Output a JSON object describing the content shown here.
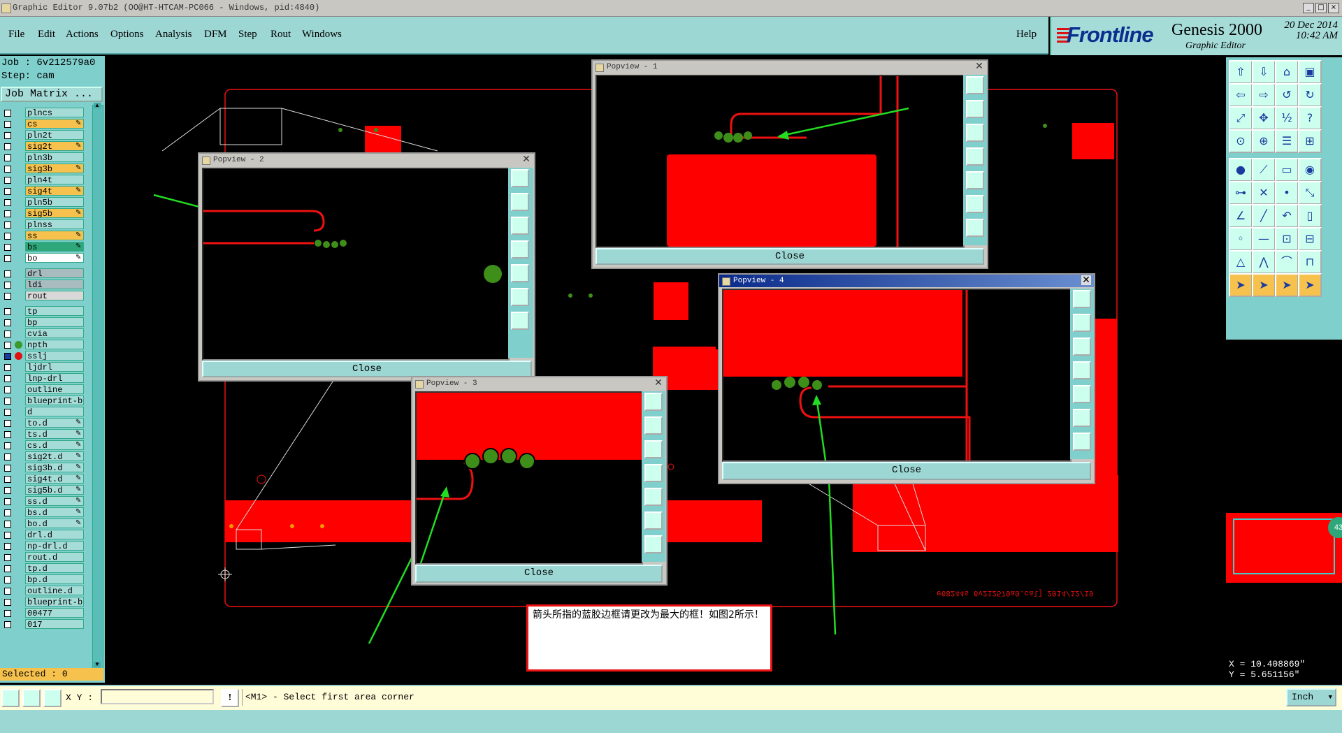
{
  "titlebar": {
    "title": "Graphic Editor 9.07b2 (OO@HT-HTCAM-PC066 - Windows, pid:4840)"
  },
  "menu": {
    "items": [
      "File",
      "Edit",
      "Actions",
      "Options",
      "Analysis",
      "DFM",
      "Step",
      "Rout",
      "Windows"
    ],
    "help": "Help"
  },
  "brand": {
    "logo": "Frontline",
    "product": "Genesis 2000",
    "subtitle": "Graphic Editor",
    "date": "20 Dec 2014",
    "time": "10:42 AM"
  },
  "left": {
    "job": "Job : 6v212579a0",
    "step": "Step: cam",
    "job_matrix": "Job Matrix ...",
    "layers": [
      {
        "name": "plncs",
        "color": "#a6dcd8"
      },
      {
        "name": "cs",
        "color": "#f6c24d",
        "editable": true
      },
      {
        "name": "pln2t",
        "color": "#a6dcd8"
      },
      {
        "name": "sig2t",
        "color": "#f6c24d",
        "editable": true
      },
      {
        "name": "pln3b",
        "color": "#a6dcd8"
      },
      {
        "name": "sig3b",
        "color": "#f6c24d",
        "editable": true
      },
      {
        "name": "pln4t",
        "color": "#a6dcd8"
      },
      {
        "name": "sig4t",
        "color": "#f6c24d",
        "editable": true
      },
      {
        "name": "pln5b",
        "color": "#a6dcd8"
      },
      {
        "name": "sig5b",
        "color": "#f6c24d",
        "editable": true
      },
      {
        "name": "plnss",
        "color": "#a6dcd8"
      },
      {
        "name": "ss",
        "color": "#f6c24d",
        "editable": true
      },
      {
        "name": "bs",
        "color": "#2ea87a",
        "editable": true
      },
      {
        "name": "bo",
        "color": "#ffffff",
        "editable": true
      },
      {
        "name": "drl",
        "color": "#a8bcc0"
      },
      {
        "name": "ldi",
        "color": "#a8bcc0"
      },
      {
        "name": "rout",
        "color": "#d8d8d8"
      },
      {
        "name": "tp",
        "color": "#a6dcd8"
      },
      {
        "name": "bp",
        "color": "#a6dcd8"
      },
      {
        "name": "cvia",
        "color": "#a6dcd8"
      },
      {
        "name": "npth",
        "color": "#a6dcd8",
        "marker": "#3a9a2a"
      },
      {
        "name": "sslj",
        "color": "#a6dcd8",
        "marker": "#e11111",
        "active": true
      },
      {
        "name": "ljdrl",
        "color": "#a6dcd8"
      },
      {
        "name": "lnp-drl",
        "color": "#a6dcd8"
      },
      {
        "name": "outline",
        "color": "#a6dcd8"
      },
      {
        "name": "blueprint-bo",
        "color": "#a6dcd8"
      },
      {
        "name": "d",
        "color": "#a6dcd8"
      },
      {
        "name": "to.d",
        "color": "#a6dcd8",
        "editable": true
      },
      {
        "name": "ts.d",
        "color": "#a6dcd8",
        "editable": true
      },
      {
        "name": "cs.d",
        "color": "#a6dcd8",
        "editable": true
      },
      {
        "name": "sig2t.d",
        "color": "#a6dcd8",
        "editable": true
      },
      {
        "name": "sig3b.d",
        "color": "#a6dcd8",
        "editable": true
      },
      {
        "name": "sig4t.d",
        "color": "#a6dcd8",
        "editable": true
      },
      {
        "name": "sig5b.d",
        "color": "#a6dcd8",
        "editable": true
      },
      {
        "name": "ss.d",
        "color": "#a6dcd8",
        "editable": true
      },
      {
        "name": "bs.d",
        "color": "#a6dcd8",
        "editable": true
      },
      {
        "name": "bo.d",
        "color": "#a6dcd8",
        "editable": true
      },
      {
        "name": "drl.d",
        "color": "#a6dcd8"
      },
      {
        "name": "np-drl.d",
        "color": "#a6dcd8"
      },
      {
        "name": "rout.d",
        "color": "#a6dcd8"
      },
      {
        "name": "tp.d",
        "color": "#a6dcd8"
      },
      {
        "name": "bp.d",
        "color": "#a6dcd8"
      },
      {
        "name": "outline.d",
        "color": "#a6dcd8"
      },
      {
        "name": "blueprint-bo",
        "color": "#a6dcd8"
      },
      {
        "name": "00477",
        "color": "#a6dcd8"
      },
      {
        "name": "017",
        "color": "#a6dcd8"
      }
    ],
    "selected": "Selected : 0"
  },
  "popviews": [
    {
      "title": "Popview - 1",
      "close": "Close"
    },
    {
      "title": "Popview - 2",
      "close": "Close"
    },
    {
      "title": "Popview - 3",
      "close": "Close"
    },
    {
      "title": "Popview - 4",
      "close": "Close"
    }
  ],
  "note": {
    "text": "箭头所指的蓝胶边框请更改为最大的框！如图2所示！"
  },
  "canvas": {
    "mirrored_text": "e68244s 6v212579a0.cal] 2014/12/19"
  },
  "coords": {
    "x": "X = 10.408869\"",
    "y": "Y = 5.651156\""
  },
  "statusbar": {
    "xy_label": "X Y :",
    "xy_value": "",
    "message": "<M1> - Select first area corner",
    "units": "Inch"
  },
  "colors": {
    "copper": "#ff0000",
    "pad": "#3e8e1a",
    "arrow": "#22dd22",
    "panel": "#7fcfcc",
    "menu": "#9cd7d4"
  }
}
